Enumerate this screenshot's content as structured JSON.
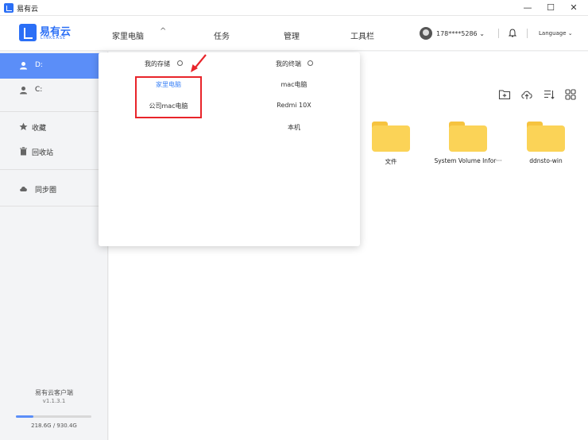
{
  "window": {
    "title": "易有云",
    "controls": [
      "—",
      "☐",
      "✕"
    ]
  },
  "brand": {
    "name": "易有云",
    "sub": "LINKEASE"
  },
  "nav": {
    "items": [
      "家里电脑",
      "任务",
      "管理",
      "工具栏"
    ],
    "caret": "^"
  },
  "user": {
    "phone": "178****5286",
    "language": "Language"
  },
  "sidebar": {
    "items": [
      {
        "label": "D:",
        "icon": "user-icon",
        "active": true
      },
      {
        "label": "C:",
        "icon": "user-icon",
        "active": false
      },
      {
        "label": "收藏",
        "icon": "star-icon",
        "active": false
      },
      {
        "label": "回收站",
        "icon": "trash-icon",
        "active": false
      },
      {
        "label": "同步圈",
        "icon": "cloud-icon",
        "active": false
      }
    ],
    "client_name": "易有云客户端",
    "client_version": "v1.1.3.1",
    "storage": {
      "used": "218.6G",
      "total": "930.4G",
      "text": "218.6G / 930.4G",
      "fraction": 0.235
    }
  },
  "toolbar": {
    "icons": [
      "new-folder-icon",
      "upload-icon",
      "sort-icon",
      "grid-view-icon"
    ]
  },
  "files": [
    {
      "name": "文件"
    },
    {
      "name": "System Volume Infor···"
    },
    {
      "name": "ddnsto-win"
    }
  ],
  "dropdown": {
    "storage_header": "我的存储",
    "terminal_header": "我的终端",
    "storage_items": [
      {
        "label": "家里电脑",
        "selected": true
      },
      {
        "label": "公司mac电脑",
        "selected": false
      }
    ],
    "terminal_items": [
      {
        "label": "mac电脑"
      },
      {
        "label": "Redmi 10X"
      },
      {
        "label": "本机"
      }
    ]
  },
  "colors": {
    "accent": "#5b8ef8",
    "brand": "#2b6ff6",
    "folder": "#fbd357",
    "highlight": "#e8242a",
    "selected_text": "#3b82f6"
  }
}
